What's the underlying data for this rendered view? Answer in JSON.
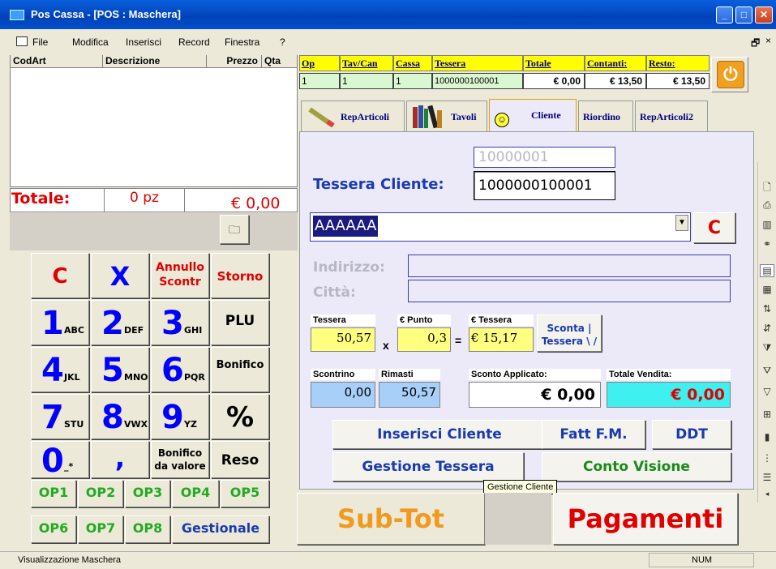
{
  "window": {
    "title": "Pos Cassa - [POS : Maschera]"
  },
  "menu": {
    "items": [
      "File",
      "Modifica",
      "Inserisci",
      "Record",
      "Finestra",
      "?"
    ]
  },
  "receipt": {
    "columns": [
      "CodArt",
      "Descrizione",
      "Prezzo",
      "Qta"
    ],
    "total_label": "Totale:",
    "total_qty": "0 pz",
    "total_amount": "€ 0,00"
  },
  "info_grid": {
    "headers": [
      "Op",
      "Tav/Can",
      "Cassa",
      "Tessera",
      "Totale",
      "Contanti:",
      "Resto:"
    ],
    "values": [
      "1",
      "1",
      "1",
      "1000000100001",
      "€ 0,00",
      "€ 13,50",
      "€ 13,50"
    ]
  },
  "tabs": [
    "RepArticoli",
    "Tavoli",
    "Cliente",
    "Riordino",
    "RepArticoli2"
  ],
  "cliente": {
    "id_value": "10000001",
    "tessera_label": "Tessera Cliente:",
    "tessera_value": "1000000100001",
    "name_value": "AAAAAA",
    "clear_button": "C",
    "indirizzo_label": "Indirizzo:",
    "citta_label": "Città:",
    "tessera_small_label": "Tessera",
    "punto_label": "€ Punto",
    "etessera_label": "€ Tessera",
    "tessera_points": "50,57",
    "punto_value": "0,3",
    "etessera_value": "€ 15,17",
    "multiply_sign": "x",
    "equals_sign": "=",
    "sconta_button": "Sconta | Tessera \\ /",
    "scontrino_label": "Scontrino",
    "rimasti_label": "Rimasti",
    "sconto_label": "Sconto Applicato:",
    "totale_vendita_label": "Totale Vendita:",
    "scontrino_value": "0,00",
    "rimasti_value": "50,57",
    "sconto_value": "€ 0,00",
    "totale_vendita_value": "€ 0,00",
    "inserisci_button": "Inserisci Cliente",
    "fatt_button": "Fatt F.M.",
    "ddt_button": "DDT",
    "gestione_button": "Gestione Tessera",
    "conto_button": "Conto Visione",
    "tooltip": "Gestione Cliente"
  },
  "bottom": {
    "subtot": "Sub-Tot",
    "pagamenti": "Pagamenti"
  },
  "keypad": {
    "c": "C",
    "x": "X",
    "annullo": "Annullo Scontr",
    "storno": "Storno",
    "plu": "PLU",
    "bonifico": "Bonifico",
    "percent": "%",
    "bonifico_valore": "Bonifico da valore",
    "reso": "Reso",
    "comma": ",",
    "nums": [
      {
        "n": "1",
        "s": "ABC"
      },
      {
        "n": "2",
        "s": "DEF"
      },
      {
        "n": "3",
        "s": "GHI"
      },
      {
        "n": "4",
        "s": "JKL"
      },
      {
        "n": "5",
        "s": "MNO"
      },
      {
        "n": "6",
        "s": "PQR"
      },
      {
        "n": "7",
        "s": "STU"
      },
      {
        "n": "8",
        "s": "VWX"
      },
      {
        "n": "9",
        "s": "YZ"
      },
      {
        "n": "0",
        "s": "_*"
      }
    ],
    "ops": [
      "OP1",
      "OP2",
      "OP3",
      "OP4",
      "OP5",
      "OP6",
      "OP7",
      "OP8"
    ],
    "gestionale": "Gestionale"
  },
  "status": {
    "left": "Visualizzazione Maschera",
    "right": "NUM"
  },
  "colors": {
    "accent": "#ff0000",
    "blue": "#0000ff",
    "orange": "#ff9900",
    "green": "#22aa22"
  }
}
